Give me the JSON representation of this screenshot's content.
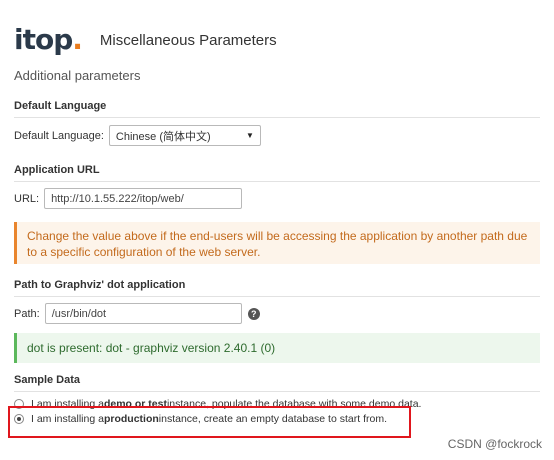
{
  "header": {
    "logo_text": "itop",
    "logo_dot": ".",
    "title": "Miscellaneous Parameters"
  },
  "subheading": "Additional parameters",
  "default_language": {
    "section_title": "Default Language",
    "label": "Default Language:",
    "selected_value": "Chinese (简体中文)"
  },
  "application_url": {
    "section_title": "Application URL",
    "label": "URL:",
    "value": "http://10.1.55.222/itop/web/",
    "warning": "Change the value above if the end-users will be accessing the application by another path due to a specific configuration of the web server."
  },
  "graphviz": {
    "section_title": "Path to Graphviz' dot application",
    "label": "Path:",
    "value": "/usr/bin/dot",
    "status": "dot is present: dot - graphviz version 2.40.1 (0)"
  },
  "sample_data": {
    "section_title": "Sample Data",
    "options": [
      {
        "prefix": "I am installing a ",
        "bold": "demo or test",
        "suffix": " instance, populate the database with some demo data.",
        "checked": false
      },
      {
        "prefix": "I am installing a ",
        "bold": "production",
        "suffix": " instance, create an empty database to start from.",
        "checked": true
      }
    ]
  },
  "watermark": "CSDN @fockrock",
  "colors": {
    "logo": "#2b3a4a",
    "logo_accent": "#ea7d1e",
    "warning_text": "#c36a1c",
    "success_border": "#5cb85c",
    "highlight": "#e0161d"
  }
}
